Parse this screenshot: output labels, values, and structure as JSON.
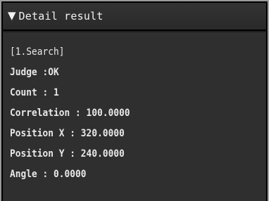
{
  "header": {
    "toggle_icon": "collapse-triangle-icon",
    "title": "Detail result"
  },
  "result": {
    "section": "[1.Search]",
    "judge": "Judge :OK",
    "count": "Count : 1",
    "correlation": "Correlation : 100.0000",
    "position_x": "Position X : 320.0000",
    "position_y": "Position Y : 240.0000",
    "angle": "Angle : 0.0000"
  }
}
